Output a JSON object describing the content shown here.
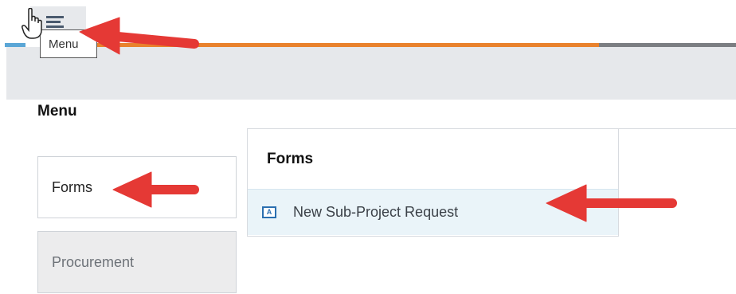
{
  "toolbar": {
    "menu_icon": "list-menu-icon",
    "tooltip": "Menu"
  },
  "progress_colors": {
    "left": "#5aa6d6",
    "middle": "#e9822d",
    "right": "#7b7e82"
  },
  "menu": {
    "title": "Menu",
    "items": [
      {
        "label": "Forms"
      },
      {
        "label": "Procurement"
      }
    ]
  },
  "flyout": {
    "title": "Forms",
    "items": [
      {
        "icon": "form-icon",
        "label": "New Sub-Project Request"
      }
    ]
  },
  "annotations": {
    "arrow_color": "#e53935",
    "arrow_count": 4
  }
}
